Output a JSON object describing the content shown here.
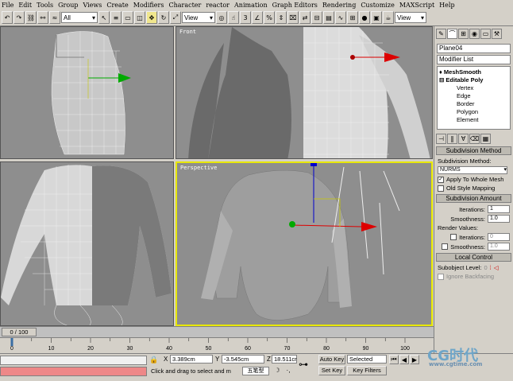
{
  "menu": {
    "items": [
      "File",
      "Edit",
      "Tools",
      "Group",
      "Views",
      "Create",
      "Modifiers",
      "Character",
      "reactor",
      "Animation",
      "Graph Editors",
      "Rendering",
      "Customize",
      "MAXScript",
      "Help"
    ]
  },
  "toolbar": {
    "selection_filter": "All",
    "ref_coord": "View",
    "ref_coord2": "View"
  },
  "viewports": {
    "front": "Front",
    "perspective": "Perspective"
  },
  "panel": {
    "object_name": "Plane04",
    "modifier_list": "Modifier List",
    "stack": {
      "meshsmooth": "MeshSmooth",
      "editable_poly": "Editable Poly",
      "subs": [
        "Vertex",
        "Edge",
        "Border",
        "Polygon",
        "Element"
      ]
    },
    "subdivision_method_header": "Subdivision Method",
    "subdivision_method_label": "Subdivision Method:",
    "subdivision_method_value": "NURMS",
    "apply_whole_mesh": "Apply To Whole Mesh",
    "old_style_mapping": "Old Style Mapping",
    "subdivision_amount_header": "Subdivision Amount",
    "iterations_label": "Iterations:",
    "iterations_value": "1",
    "smoothness_label": "Smoothness:",
    "smoothness_value": "1.0",
    "render_values_label": "Render Values:",
    "render_iterations_label": "Iterations:",
    "render_iterations_value": "0",
    "render_smoothness_label": "Smoothness:",
    "render_smoothness_value": "1.0",
    "local_control_header": "Local Control",
    "subobject_level_label": "Subobject Level:",
    "subobject_level_value": "0",
    "ignore_backfacing": "Ignore Backfacing"
  },
  "timeline": {
    "frame_display": "0 / 100",
    "ticks": [
      "0",
      "10",
      "20",
      "30",
      "40",
      "50",
      "60",
      "70",
      "80",
      "90",
      "100"
    ],
    "position": 0
  },
  "status": {
    "x_label": "X",
    "x_value": "3.389cm",
    "y_label": "Y",
    "y_value": "-3.545cm",
    "z_label": "Z",
    "z_value": "18.511cr",
    "prompt": "Click and drag to select and m",
    "grid_text": "五笔型",
    "auto_key": "Auto Key",
    "set_key": "Set Key",
    "selected": "Selected",
    "key_filters": "Key Filters"
  },
  "watermark": {
    "brand": "CG时代",
    "url": "www.cgtime.com"
  }
}
